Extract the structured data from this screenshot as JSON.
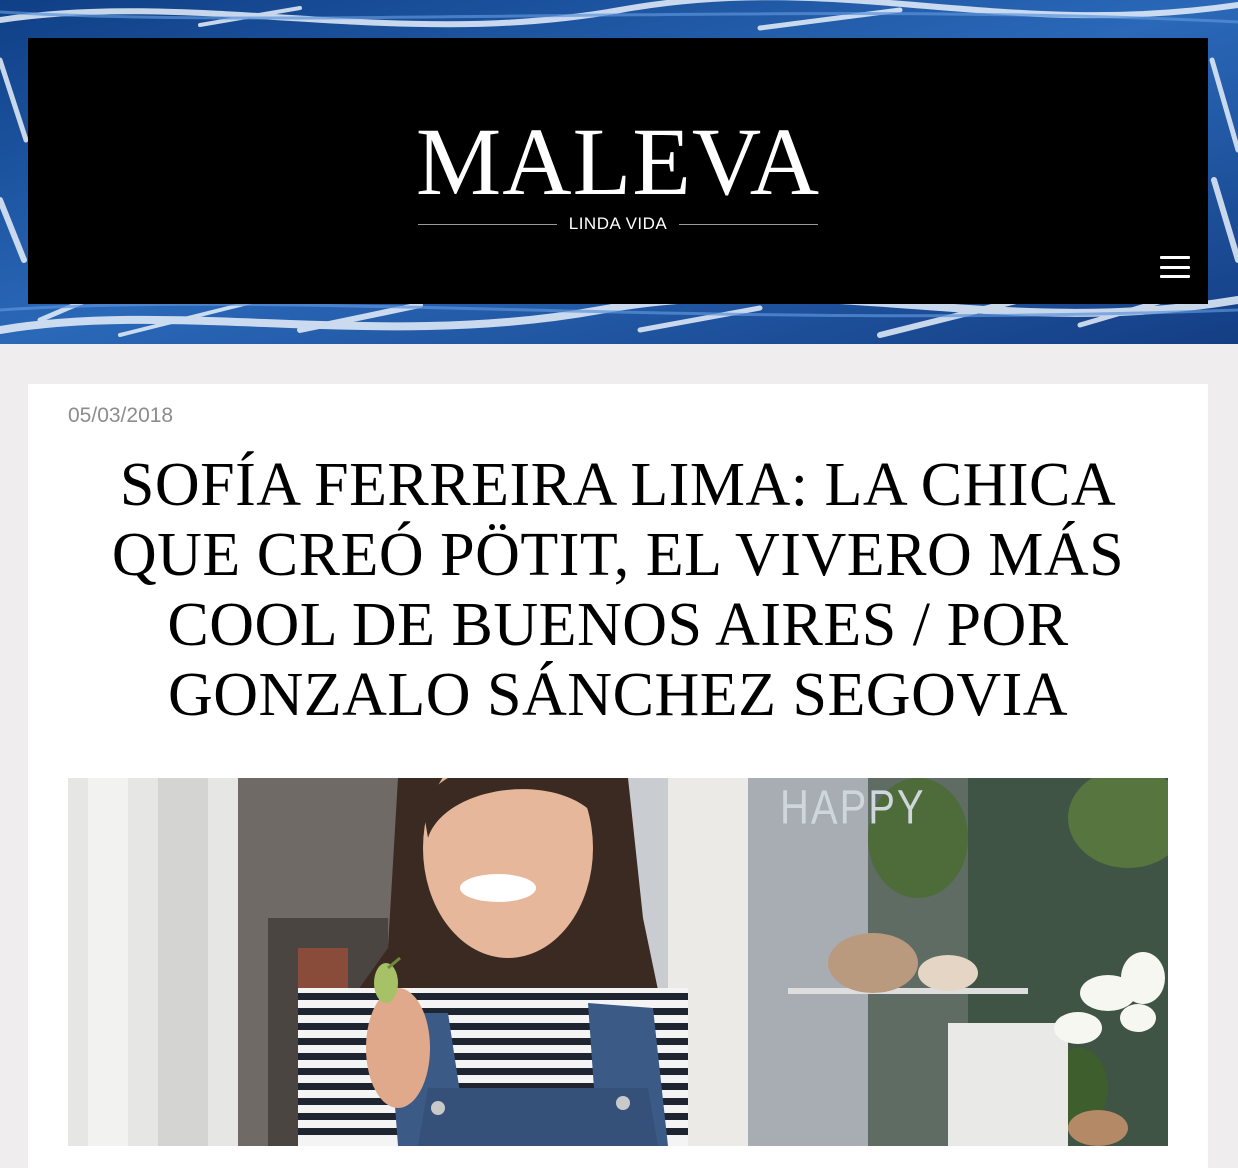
{
  "site": {
    "logo": "MALEVA",
    "tagline": "LINDA VIDA",
    "menu_icon": "hamburger-menu-icon"
  },
  "article": {
    "date": "05/03/2018",
    "title": "SOFÍA FERREIRA LIMA: LA CHICA QUE CREÓ PÖTIT, EL VIVERO MÁS COOL DE BUENOS AIRES / POR GONZALO SÁNCHEZ SEGOVIA",
    "photo_sign": "HAPPY"
  },
  "colors": {
    "page_background": "#efedee",
    "masthead": "#000000",
    "hero_water": "#1c4f9a",
    "date_text": "#8c8c8c"
  }
}
